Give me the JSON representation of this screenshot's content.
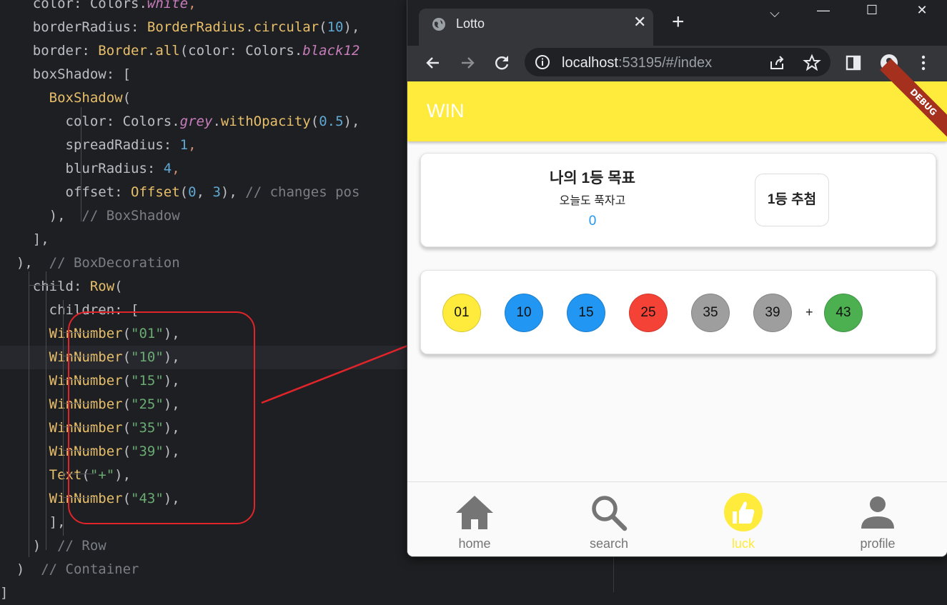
{
  "editor": {
    "lines": [
      [
        [
          "t-plain",
          "    color: "
        ],
        [
          "t-plain",
          "Colors."
        ],
        [
          "t-it",
          "white"
        ],
        [
          "t-pun",
          ","
        ]
      ],
      [
        [
          "t-plain",
          "    borderRadius: "
        ],
        [
          "t-cls",
          "BorderRadius"
        ],
        [
          "t-plain",
          "."
        ],
        [
          "t-cls",
          "circular"
        ],
        [
          "t-plain",
          "("
        ],
        [
          "t-numb",
          "10"
        ],
        [
          "t-plain",
          "),"
        ]
      ],
      [
        [
          "t-plain",
          "    border: "
        ],
        [
          "t-cls",
          "Border"
        ],
        [
          "t-plain",
          "."
        ],
        [
          "t-cls",
          "all"
        ],
        [
          "t-plain",
          "(color: Colors."
        ],
        [
          "t-it",
          "black12"
        ]
      ],
      [
        [
          "t-plain",
          "    boxShadow: ["
        ]
      ],
      [
        [
          "t-cls",
          "      BoxShadow"
        ],
        [
          "t-plain",
          "("
        ]
      ],
      [
        [
          "t-plain",
          "        color: Colors."
        ],
        [
          "t-it",
          "grey"
        ],
        [
          "t-plain",
          "."
        ],
        [
          "t-cls",
          "withOpacity"
        ],
        [
          "t-plain",
          "("
        ],
        [
          "t-numb",
          "0.5"
        ],
        [
          "t-plain",
          "),"
        ]
      ],
      [
        [
          "t-plain",
          "        spreadRadius: "
        ],
        [
          "t-numb",
          "1"
        ],
        [
          "t-pun",
          ","
        ]
      ],
      [
        [
          "t-plain",
          "        blurRadius: "
        ],
        [
          "t-numb",
          "4"
        ],
        [
          "t-pun",
          ","
        ]
      ],
      [
        [
          "t-plain",
          "        offset: "
        ],
        [
          "t-cls",
          "Offset"
        ],
        [
          "t-plain",
          "("
        ],
        [
          "t-numb",
          "0"
        ],
        [
          "t-plain",
          ", "
        ],
        [
          "t-numb",
          "3"
        ],
        [
          "t-plain",
          "), "
        ],
        [
          "t-cm",
          "// changes pos"
        ]
      ],
      [
        [
          "t-plain",
          "      ), "
        ],
        [
          "t-cm",
          " // BoxShadow"
        ]
      ],
      [
        [
          "t-plain",
          "    ],"
        ]
      ],
      [
        [
          "t-plain",
          "  ), "
        ],
        [
          "t-cm",
          " // BoxDecoration"
        ]
      ],
      [
        [
          "t-plain",
          "    child: "
        ],
        [
          "t-cls",
          "Row"
        ],
        [
          "t-plain",
          "("
        ]
      ],
      [
        [
          "t-plain",
          "      children: ["
        ]
      ],
      [
        [
          "t-cls",
          "      WinNumber"
        ],
        [
          "t-plain",
          "("
        ],
        [
          "t-str",
          "\"01\""
        ],
        [
          "t-plain",
          "),"
        ]
      ],
      [
        [
          "t-cls",
          "      WinNumber"
        ],
        [
          "t-plain",
          "("
        ],
        [
          "t-str",
          "\"10\""
        ],
        [
          "t-plain",
          "),"
        ]
      ],
      [
        [
          "t-cls",
          "      WinNumber"
        ],
        [
          "t-plain",
          "("
        ],
        [
          "t-str",
          "\"15\""
        ],
        [
          "t-plain",
          "),"
        ]
      ],
      [
        [
          "t-cls",
          "      WinNumber"
        ],
        [
          "t-plain",
          "("
        ],
        [
          "t-str",
          "\"25\""
        ],
        [
          "t-plain",
          "),"
        ]
      ],
      [
        [
          "t-cls",
          "      WinNumber"
        ],
        [
          "t-plain",
          "("
        ],
        [
          "t-str",
          "\"35\""
        ],
        [
          "t-plain",
          "),"
        ]
      ],
      [
        [
          "t-cls",
          "      WinNumber"
        ],
        [
          "t-plain",
          "("
        ],
        [
          "t-str",
          "\"39\""
        ],
        [
          "t-plain",
          "),"
        ]
      ],
      [
        [
          "t-cls",
          "      Text"
        ],
        [
          "t-plain",
          "("
        ],
        [
          "t-str",
          "\"+\""
        ],
        [
          "t-plain",
          "),"
        ]
      ],
      [
        [
          "t-cls",
          "      WinNumber"
        ],
        [
          "t-plain",
          "("
        ],
        [
          "t-str",
          "\"43\""
        ],
        [
          "t-plain",
          "),"
        ]
      ],
      [
        [
          "t-plain",
          "      ],"
        ]
      ],
      [
        [
          "t-plain",
          "    ) "
        ],
        [
          "t-cm",
          " // Row"
        ]
      ],
      [
        [
          "t-plain",
          "  ) "
        ],
        [
          "t-cm",
          " // Container"
        ]
      ],
      [
        [
          "t-plain",
          "]"
        ]
      ]
    ],
    "highlighted_line": 15
  },
  "browser": {
    "tab_title": "Lotto",
    "tab_close": "✕",
    "new_tab": "+",
    "window_controls": {
      "menu": "⌵",
      "minimize": "—",
      "maximize": "☐",
      "close": "✕"
    },
    "url_host": "localhost",
    "url_rest": ":53195/#/index"
  },
  "app": {
    "appbar_title": "WIN",
    "debug_banner": "DEBUG",
    "goal": {
      "heading": "나의 1등 목표",
      "subtitle": "오늘도 푹자고",
      "count": "0",
      "button_label": "1등 추첨"
    },
    "numbers": [
      {
        "value": "01",
        "color": "#ffeb3b"
      },
      {
        "value": "10",
        "color": "#2196f3"
      },
      {
        "value": "15",
        "color": "#2196f3"
      },
      {
        "value": "25",
        "color": "#f44336"
      },
      {
        "value": "35",
        "color": "#9e9e9e"
      },
      {
        "value": "39",
        "color": "#9e9e9e"
      }
    ],
    "plus": "+",
    "bonus": {
      "value": "43",
      "color": "#4caf50"
    },
    "nav": [
      {
        "label": "home",
        "icon": "home-icon",
        "active": false
      },
      {
        "label": "search",
        "icon": "search-icon",
        "active": false
      },
      {
        "label": "luck",
        "icon": "thumb-up-icon",
        "active": true
      },
      {
        "label": "profile",
        "icon": "person-icon",
        "active": false
      }
    ],
    "colors": {
      "accent": "#ffeb3b",
      "inactive_nav": "#757575"
    }
  }
}
